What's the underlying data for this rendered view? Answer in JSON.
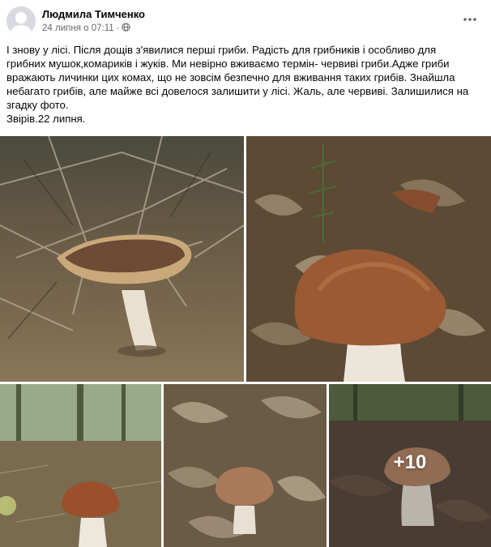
{
  "post": {
    "author": "Людмила Тимченко",
    "date": "24 липня о 07:11",
    "separator": "·",
    "audience_icon": "globe-icon",
    "menu_icon": "more-dots-icon",
    "text_lines": [
      "І знову у лісі. Після дощів з'явилися перші гриби. Радість для грибників і особливо для",
      "грибних мушок,комариків і жуків. Ми невірно вживаємо термін- червиві гриби.Адже гриби",
      "вражають личинки цих комах, що не зовсім безпечно для вживання  таких грибів. Знайшла",
      "небагато грибів, але майже всі довелося залишити у лісі. Жаль, але червиві. Залишилися на",
      "згадку фото.",
      "Звірів.22 липня."
    ]
  },
  "photos": {
    "more_count": "+10"
  },
  "colors": {
    "text": "#050505",
    "meta": "#65676b",
    "avatar_bg": "#d8dadf",
    "avatar_fg": "#ffffff"
  }
}
